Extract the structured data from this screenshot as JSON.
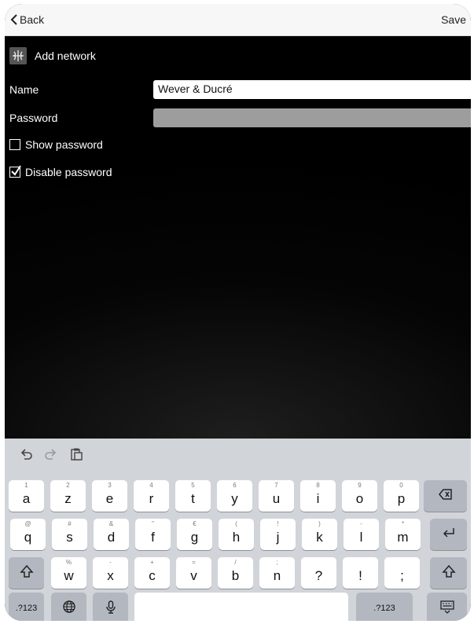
{
  "navbar": {
    "back_label": "Back",
    "save_label": "Save"
  },
  "header": {
    "title": "Add network",
    "icon": "network-app-icon"
  },
  "form": {
    "name_label": "Name",
    "name_value": "Wever & Ducré",
    "password_label": "Password",
    "password_value": "",
    "show_password_label": "Show password",
    "show_password_checked": false,
    "disable_password_label": "Disable password",
    "disable_password_checked": true
  },
  "keyboard": {
    "shortcuts": [
      "undo-icon",
      "redo-icon",
      "paste-icon"
    ],
    "row1": [
      {
        "hint": "1",
        "key": "a"
      },
      {
        "hint": "2",
        "key": "z"
      },
      {
        "hint": "3",
        "key": "e"
      },
      {
        "hint": "4",
        "key": "r"
      },
      {
        "hint": "5",
        "key": "t"
      },
      {
        "hint": "6",
        "key": "y"
      },
      {
        "hint": "7",
        "key": "u"
      },
      {
        "hint": "8",
        "key": "i"
      },
      {
        "hint": "9",
        "key": "o"
      },
      {
        "hint": "0",
        "key": "p"
      }
    ],
    "row2": [
      {
        "hint": "@",
        "key": "q"
      },
      {
        "hint": "#",
        "key": "s"
      },
      {
        "hint": "&",
        "key": "d"
      },
      {
        "hint": "\"",
        "key": "f"
      },
      {
        "hint": "€",
        "key": "g"
      },
      {
        "hint": "(",
        "key": "h"
      },
      {
        "hint": "!",
        "key": "j"
      },
      {
        "hint": ")",
        "key": "k"
      },
      {
        "hint": "-",
        "key": "l"
      },
      {
        "hint": "*",
        "key": "m"
      }
    ],
    "row3": [
      {
        "hint": "%",
        "key": "w"
      },
      {
        "hint": "-",
        "key": "x"
      },
      {
        "hint": "+",
        "key": "c"
      },
      {
        "hint": "=",
        "key": "v"
      },
      {
        "hint": "/",
        "key": "b"
      },
      {
        "hint": ";",
        "key": "n"
      },
      {
        "hint": "",
        "key": "?"
      },
      {
        "hint": "",
        "key": "!"
      },
      {
        "hint": "",
        "key": ";"
      }
    ],
    "numbers_label_left": ".?123",
    "numbers_label_right": ".?123",
    "space_label": ""
  }
}
